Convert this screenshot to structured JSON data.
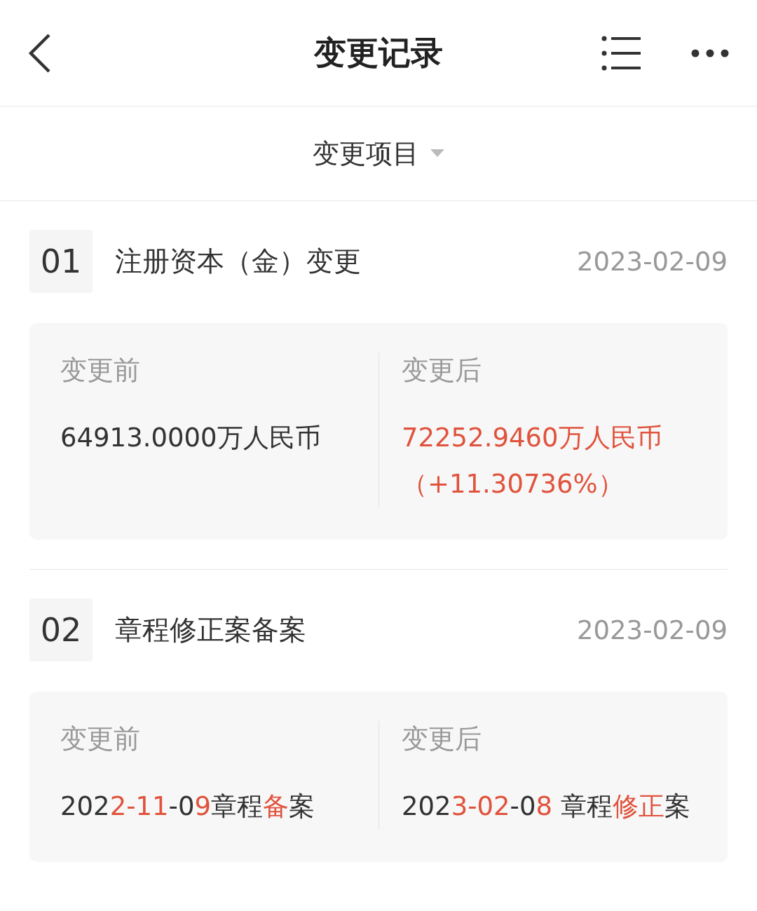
{
  "header": {
    "title": "变更记录"
  },
  "filter": {
    "label": "变更项目"
  },
  "records": [
    {
      "number": "01",
      "title": "注册资本（金）变更",
      "date": "2023-02-09",
      "before_label": "变更前",
      "after_label": "变更后",
      "before": [
        {
          "text": "64913.0000万人民币",
          "changed": false
        }
      ],
      "after": [
        {
          "text": "72252.9460万人民币",
          "changed": true
        }
      ],
      "delta": "（+11.30736%）"
    },
    {
      "number": "02",
      "title": "章程修正案备案",
      "date": "2023-02-09",
      "before_label": "变更前",
      "after_label": "变更后",
      "before": [
        {
          "text": "202",
          "changed": false
        },
        {
          "text": "2-11",
          "changed": true
        },
        {
          "text": "-0",
          "changed": false
        },
        {
          "text": "9",
          "changed": true
        },
        {
          "text": "章程",
          "changed": false
        },
        {
          "text": "备",
          "changed": true
        },
        {
          "text": "案",
          "changed": false
        }
      ],
      "after": [
        {
          "text": "202",
          "changed": false
        },
        {
          "text": "3-02",
          "changed": true
        },
        {
          "text": "-0",
          "changed": false
        },
        {
          "text": "8",
          "changed": true
        },
        {
          "text": " 章程",
          "changed": false
        },
        {
          "text": "修正",
          "changed": true
        },
        {
          "text": "案",
          "changed": false
        }
      ]
    }
  ]
}
